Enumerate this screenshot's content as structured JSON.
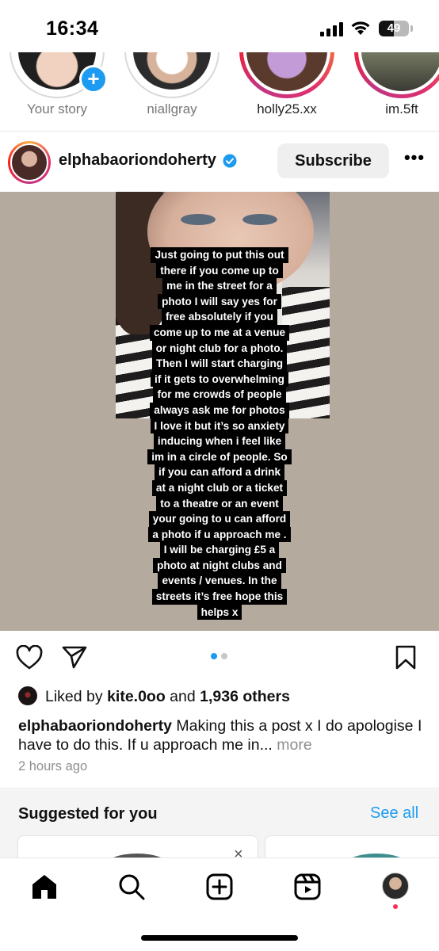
{
  "status_bar": {
    "time": "16:34",
    "battery": "49",
    "battery_level": 0.49
  },
  "stories": [
    {
      "label": "Your story",
      "seen": true,
      "add_badge": "+"
    },
    {
      "label": "niallgray",
      "seen": true
    },
    {
      "label": "holly25.xx",
      "seen": false
    },
    {
      "label": "im.5ft",
      "seen": false
    }
  ],
  "post": {
    "username": "elphabaoriondoherty",
    "verified": true,
    "subscribe_label": "Subscribe",
    "more_label": "•••",
    "text_overlay": [
      "Just going to put this out",
      "there if you come up to",
      "me in the street for a",
      "photo I will say yes for",
      "free absolutely if you",
      "come up to me at a venue",
      "or night club for a photo.",
      "Then I will start charging",
      "if it gets to overwhelming",
      "for me crowds of people",
      "always ask me for photos",
      "I love it but it’s so anxiety",
      "inducing when i feel like",
      "im in a circle of people. So",
      "if you can afford a drink",
      "at a night club or a ticket",
      "to a theatre or an event",
      "your going to u can afford",
      "a photo if u approach me .",
      "I will be charging £5 a",
      "photo at night clubs and",
      "events / venues. In the",
      "streets it’s free hope this",
      "helps x"
    ],
    "carousel": {
      "count": 2,
      "active_index": 0,
      "active_color": "#1d9bf0",
      "inactive_color": "#c7c7c7"
    },
    "likes": {
      "prefix": "Liked by ",
      "user": "kite.0oo",
      "middle": " and ",
      "others": "1,936 others"
    },
    "caption": {
      "username": "elphabaoriondoherty",
      "text": " Making this a post x I do apologise I have to do this. If u approach me in... ",
      "more_label": "more"
    },
    "timestamp": "2 hours ago"
  },
  "suggested": {
    "title": "Suggested for you",
    "see_all": "See all",
    "close_label": "×"
  },
  "tabbar": [
    "home-icon",
    "search-icon",
    "create-icon",
    "reels-icon",
    "profile-avatar"
  ],
  "colors": {
    "accent": "#1d9bf0",
    "notification": "#ff2d55"
  }
}
